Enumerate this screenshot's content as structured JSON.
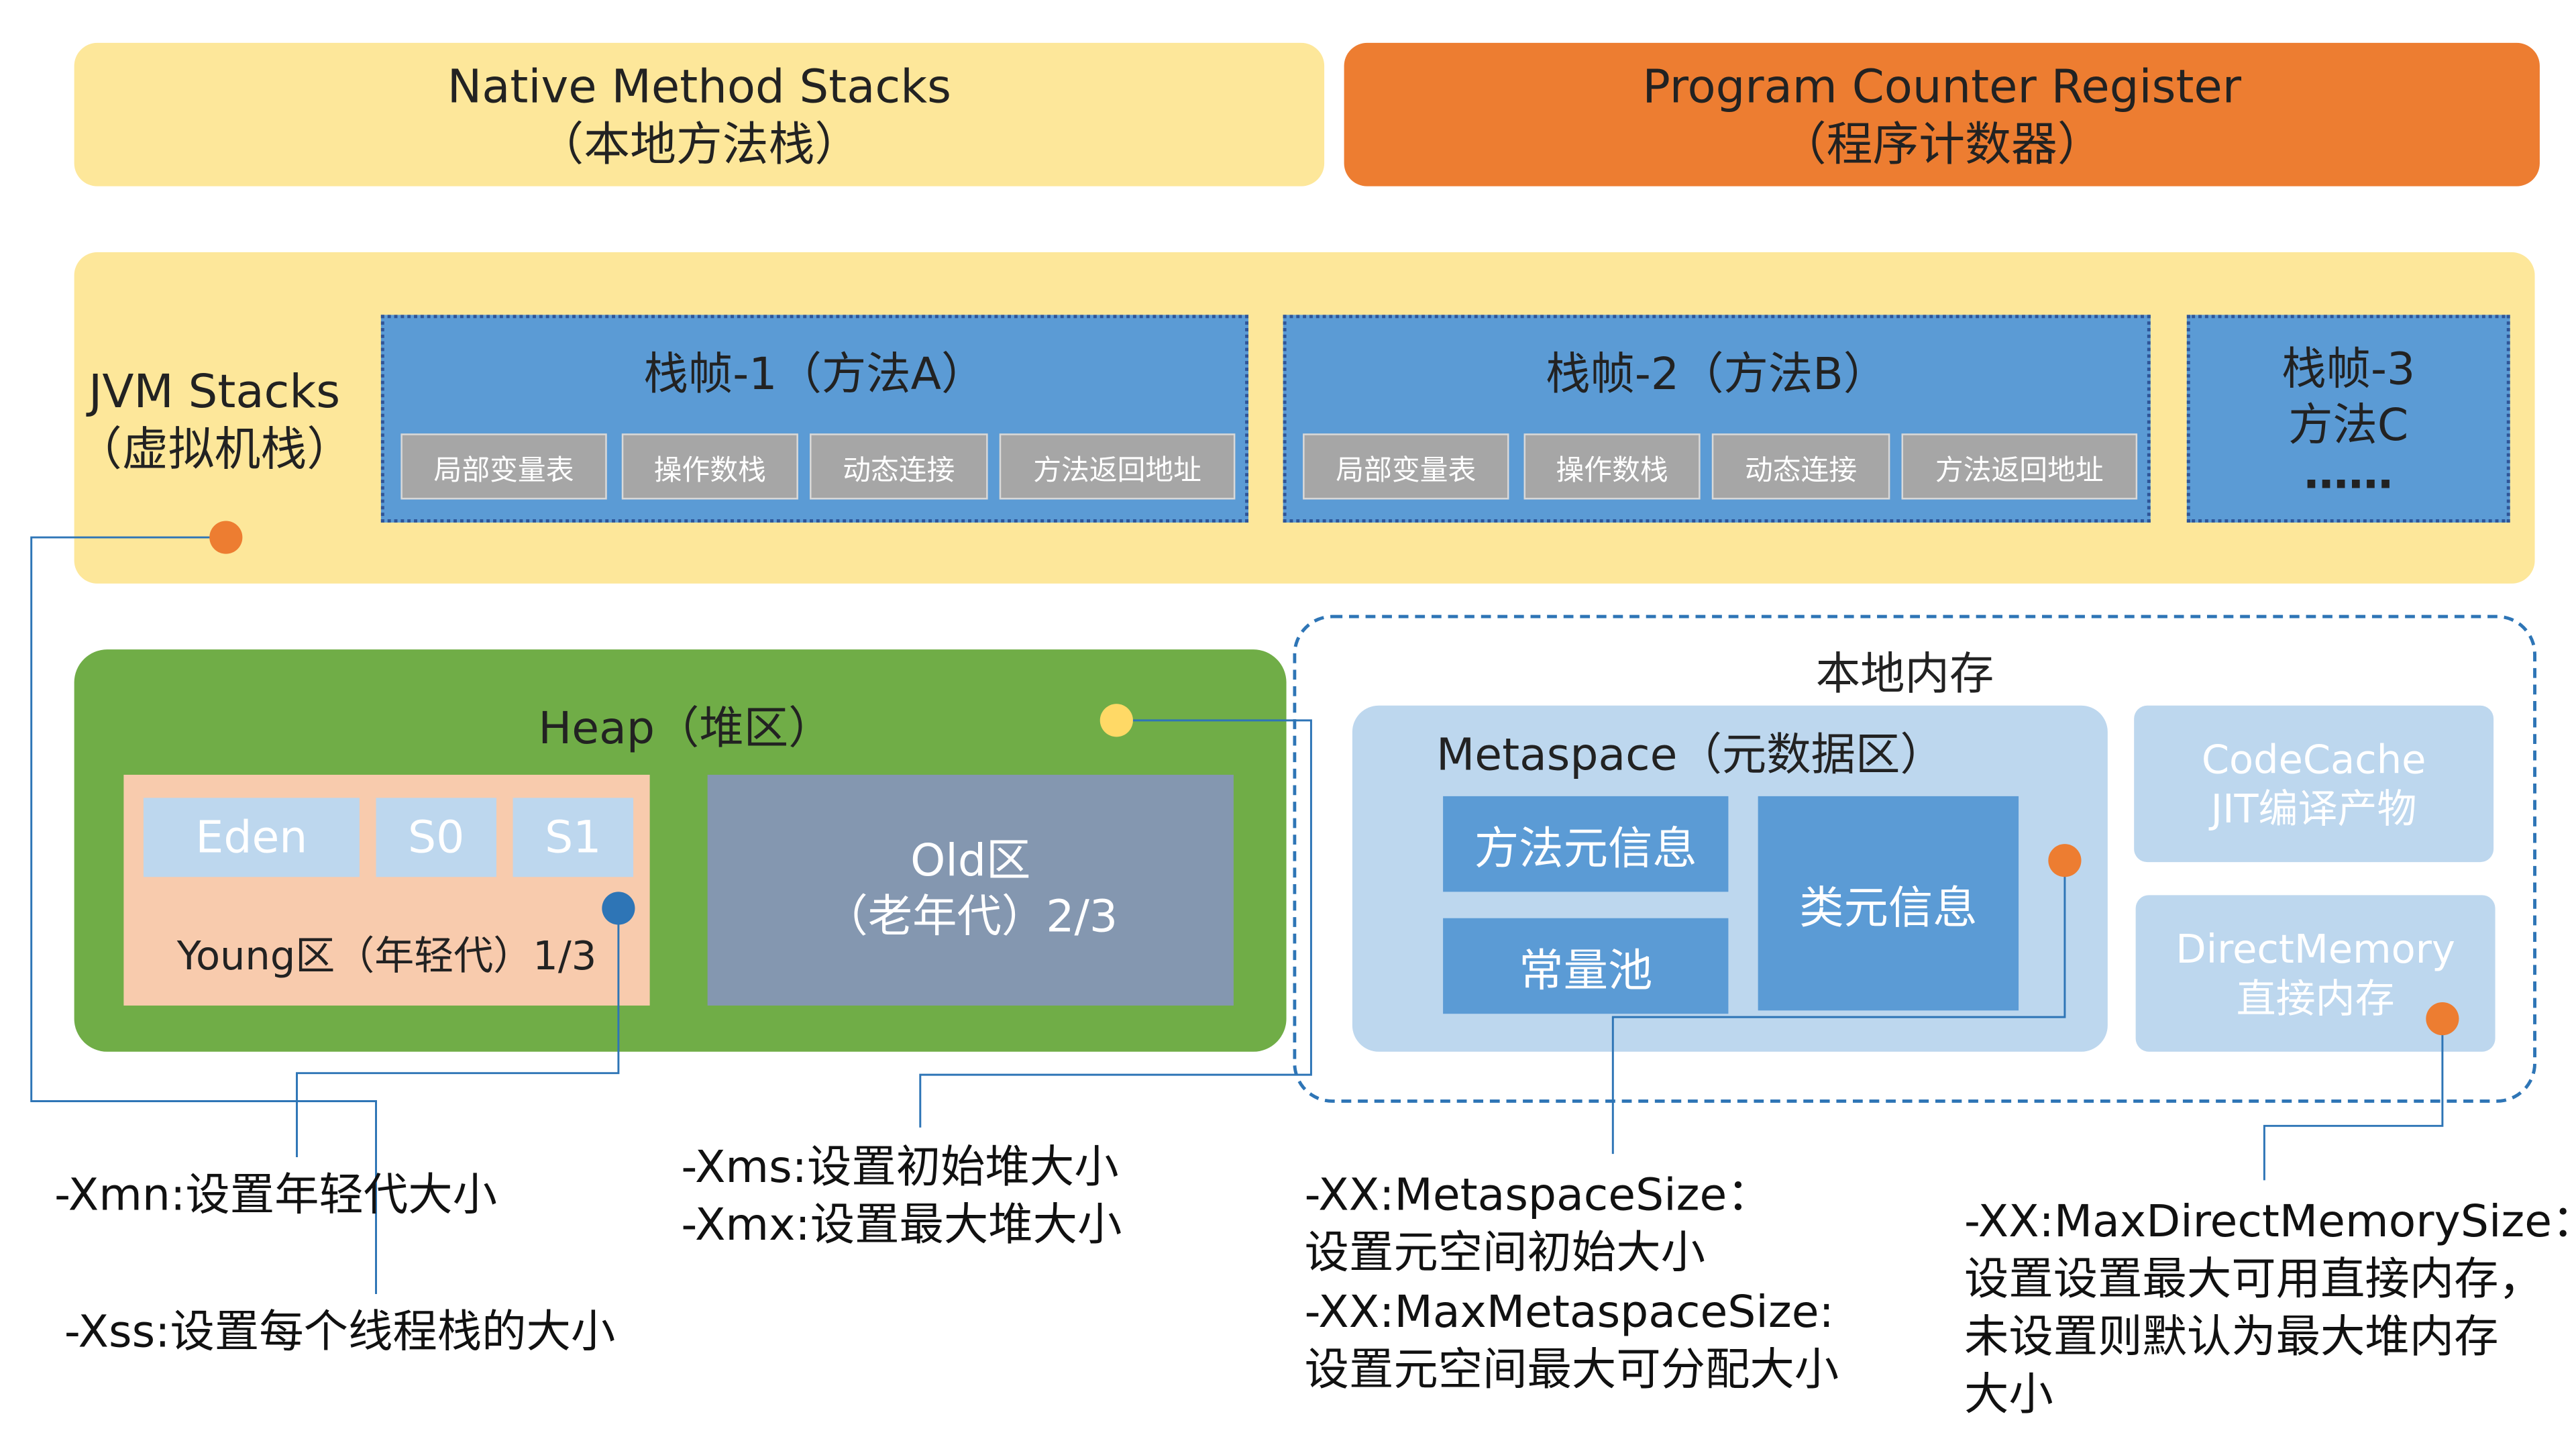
{
  "native_stack": {
    "line1": "Native Method Stacks",
    "line2": "（本地方法栈）"
  },
  "pc_register": {
    "line1": "Program Counter Register",
    "line2": "（程序计数器）"
  },
  "jvm_stacks": {
    "line1": "JVM Stacks",
    "line2": "（虚拟机栈）",
    "frame1": {
      "title": "栈帧-1（方法A）",
      "items": [
        "局部变量表",
        "操作数栈",
        "动态连接",
        "方法返回地址"
      ]
    },
    "frame2": {
      "title": "栈帧-2（方法B）",
      "items": [
        "局部变量表",
        "操作数栈",
        "动态连接",
        "方法返回地址"
      ]
    },
    "frame3": {
      "line1": "栈帧-3",
      "line2": "方法C",
      "line3": "……"
    }
  },
  "heap": {
    "title": "Heap（堆区）",
    "eden": "Eden",
    "s0": "S0",
    "s1": "S1",
    "young": "Young区（年轻代）1/3",
    "old_line1": "Old区",
    "old_line2": "（老年代）2/3"
  },
  "native_memory": {
    "title": "本地内存",
    "metaspace_title": "Metaspace（元数据区）",
    "method_meta": "方法元信息",
    "const_pool": "常量池",
    "class_meta": "类元信息",
    "codecache_line1": "CodeCache",
    "codecache_line2": "JIT编译产物",
    "direct_line1": "DirectMemory",
    "direct_line2": "直接内存"
  },
  "notes": {
    "xmn": "-Xmn:设置年轻代大小",
    "xss": "-Xss:设置每个线程栈的大小",
    "xms": "-Xms:设置初始堆大小",
    "xmx": "-Xmx:设置最大堆大小",
    "meta1": "-XX:MetaspaceSize：",
    "meta2": "设置元空间初始大小",
    "meta3": "-XX:MaxMetaspaceSize:",
    "meta4": "设置元空间最大可分配大小",
    "direct1": "-XX:MaxDirectMemorySize：",
    "direct2": "设置设置最大可用直接内存，",
    "direct3": "未设置则默认为最大堆内存",
    "direct4": "大小"
  },
  "colors": {
    "pale_yellow": "#fde79a",
    "orange": "#ed7d31",
    "blue": "#5b9bd5",
    "green": "#70ad47",
    "salmon": "#f8cbad",
    "slate": "#8497b0",
    "light_blue": "#bdd7ee",
    "gray_cell": "#a6a6a6",
    "dot_blue": "#2e75b6",
    "dot_yellow": "#ffd966"
  }
}
